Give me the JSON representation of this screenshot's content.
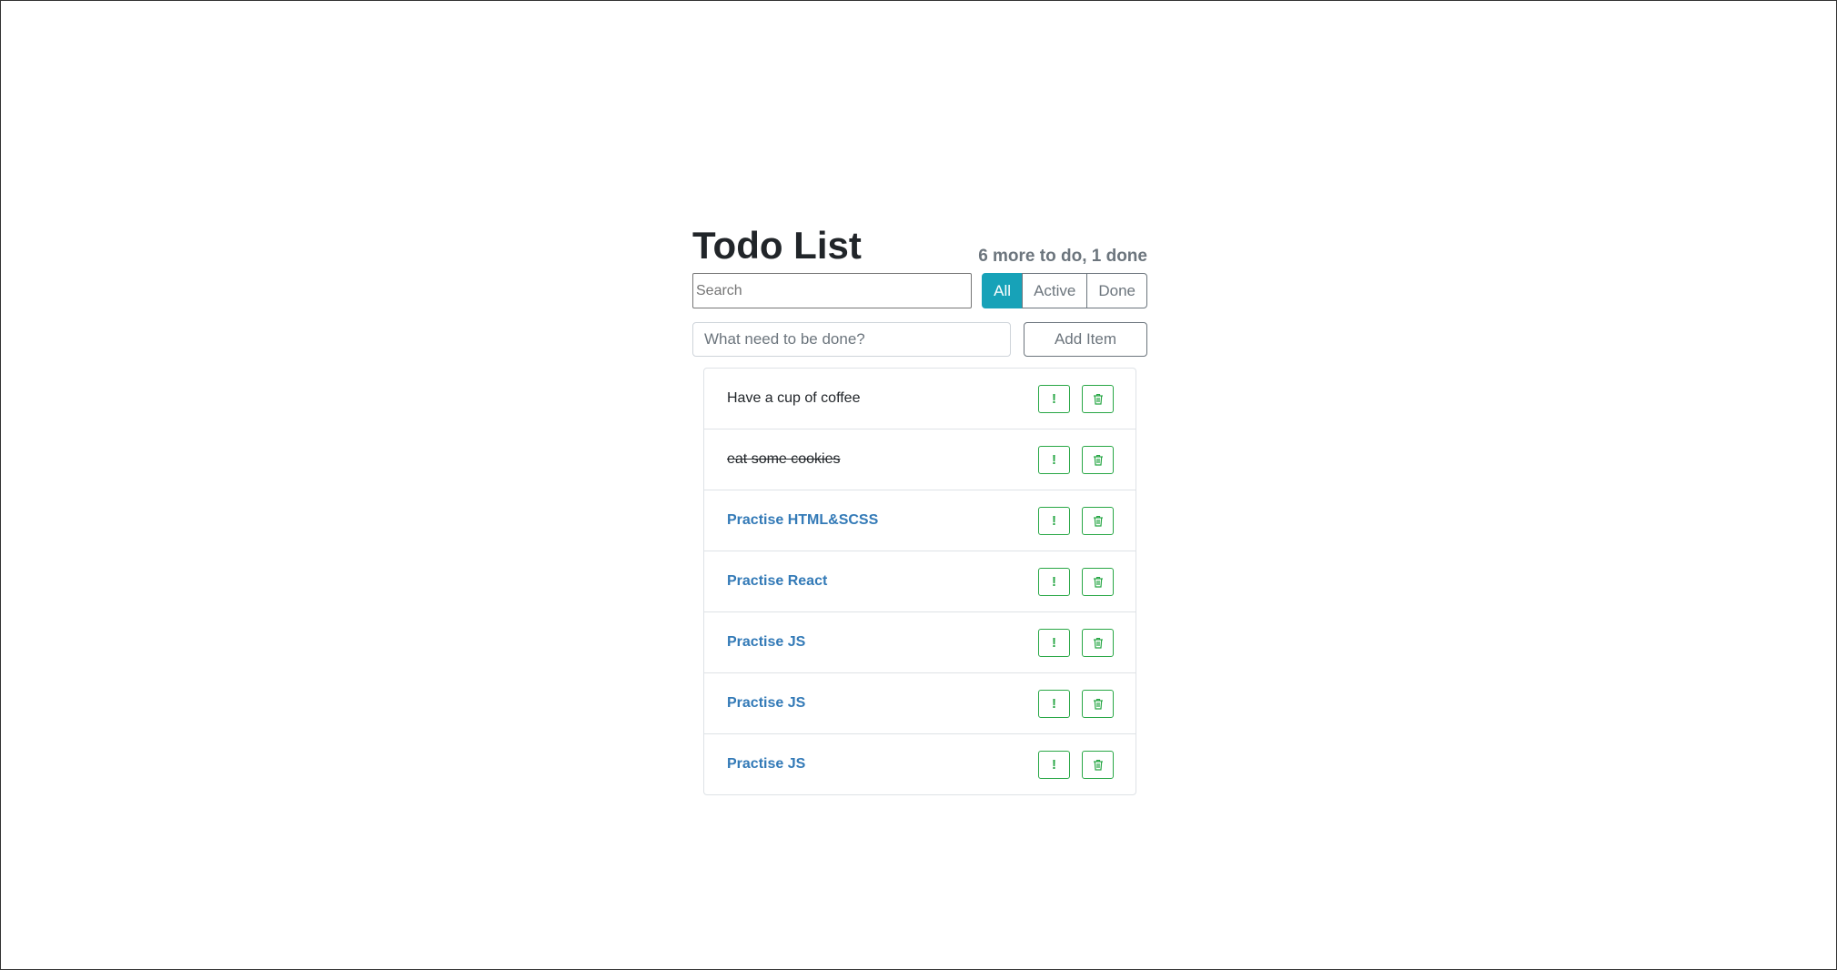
{
  "app": {
    "title": "Todo List",
    "status_text": "6 more to do, 1 done"
  },
  "search": {
    "placeholder": "Search",
    "value": ""
  },
  "filters": [
    {
      "label": "All",
      "active": true
    },
    {
      "label": "Active",
      "active": false
    },
    {
      "label": "Done",
      "active": false
    }
  ],
  "add_form": {
    "placeholder": "What need to be done?",
    "button_label": "Add Item"
  },
  "todos": [
    {
      "label": "Have a cup of coffee",
      "done": false,
      "important": false
    },
    {
      "label": "eat some cookies",
      "done": true,
      "important": false
    },
    {
      "label": "Practise HTML&SCSS",
      "done": false,
      "important": true
    },
    {
      "label": "Practise React",
      "done": false,
      "important": true
    },
    {
      "label": "Practise JS",
      "done": false,
      "important": true
    },
    {
      "label": "Practise JS",
      "done": false,
      "important": true
    },
    {
      "label": "Practise JS",
      "done": false,
      "important": true
    }
  ],
  "icons": {
    "important": "exclamation-icon",
    "delete": "trash-icon"
  },
  "colors": {
    "accent": "#17a2b8",
    "important_text": "#337ab7",
    "action_green": "#28a745"
  }
}
